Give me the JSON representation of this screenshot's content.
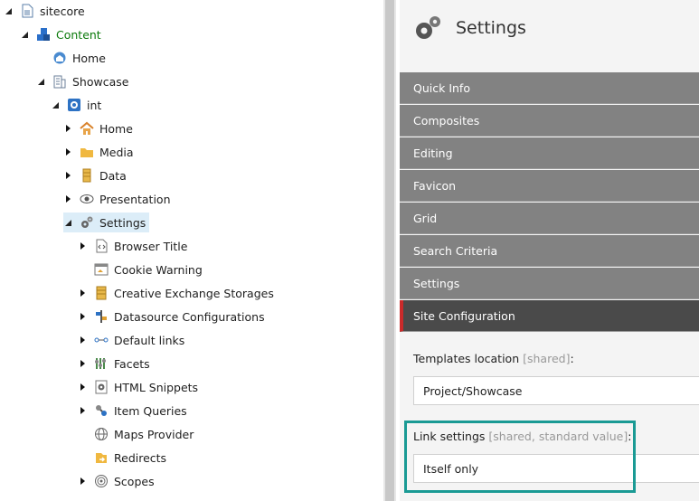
{
  "tree": {
    "sitecore": "sitecore",
    "content": "Content",
    "home_top": "Home",
    "showcase": "Showcase",
    "int": "int",
    "home": "Home",
    "media": "Media",
    "data": "Data",
    "presentation": "Presentation",
    "settings": "Settings",
    "children": [
      "Browser Title",
      "Cookie Warning",
      "Creative Exchange Storages",
      "Datasource Configurations",
      "Default links",
      "Facets",
      "HTML Snippets",
      "Item Queries",
      "Maps Provider",
      "Redirects",
      "Scopes"
    ]
  },
  "pane": {
    "title": "Settings",
    "sections": [
      "Quick Info",
      "Composites",
      "Editing",
      "Favicon",
      "Grid",
      "Search Criteria",
      "Settings",
      "Site Configuration"
    ],
    "templates_label": "Templates location",
    "templates_hint": "[shared]",
    "templates_value": "Project/Showcase",
    "link_label": "Link settings",
    "link_hint": "[shared, standard value]",
    "link_value": "Itself only",
    "colon": ":"
  },
  "colors": {
    "accent": "#1a9a94",
    "active_marker": "#c92a2a",
    "section_bg": "#828282",
    "active_bg": "#4a4a4a"
  }
}
